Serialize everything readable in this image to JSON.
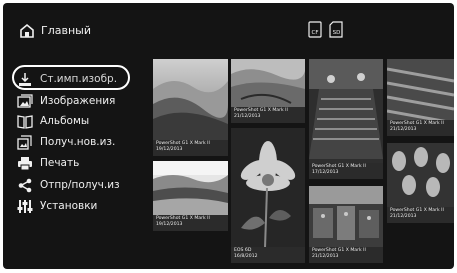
{
  "header": {
    "title": "Главный",
    "cards": [
      "CF",
      "SD"
    ]
  },
  "menu": {
    "items": [
      {
        "label": "Ст.имп.изобр.",
        "icon": "import-icon",
        "selected": true
      },
      {
        "label": "Изображения",
        "icon": "images-icon"
      },
      {
        "label": "Альбомы",
        "icon": "albums-icon"
      },
      {
        "label": "Получ.нов.из.",
        "icon": "new-images-icon"
      },
      {
        "label": "Печать",
        "icon": "printer-icon"
      },
      {
        "label": "Отпр/получ.из",
        "icon": "share-icon"
      },
      {
        "label": "Установки",
        "icon": "settings-icon"
      }
    ]
  },
  "thumbnails": [
    {
      "subject": "desert dunes",
      "model": "PowerShot G1 X Mark II",
      "date": "19/12/2013"
    },
    {
      "subject": "desert dunes wide",
      "model": "PowerShot G1 X Mark II",
      "date": "19/12/2013"
    },
    {
      "subject": "dunes",
      "model": "PowerShot G1 X Mark II",
      "date": "21/12/2013"
    },
    {
      "subject": "flower",
      "model": "EOS 6D",
      "date": "16/8/2012"
    },
    {
      "subject": "street lanterns",
      "model": "PowerShot G1 X Mark II",
      "date": "17/12/2013"
    },
    {
      "subject": "market",
      "model": "PowerShot G1 X Mark II",
      "date": "21/12/2013"
    },
    {
      "subject": "carpets",
      "model": "PowerShot G1 X Mark II",
      "date": "21/12/2013"
    },
    {
      "subject": "lanterns",
      "model": "PowerShot G1 X Mark II",
      "date": "21/12/2013"
    }
  ]
}
